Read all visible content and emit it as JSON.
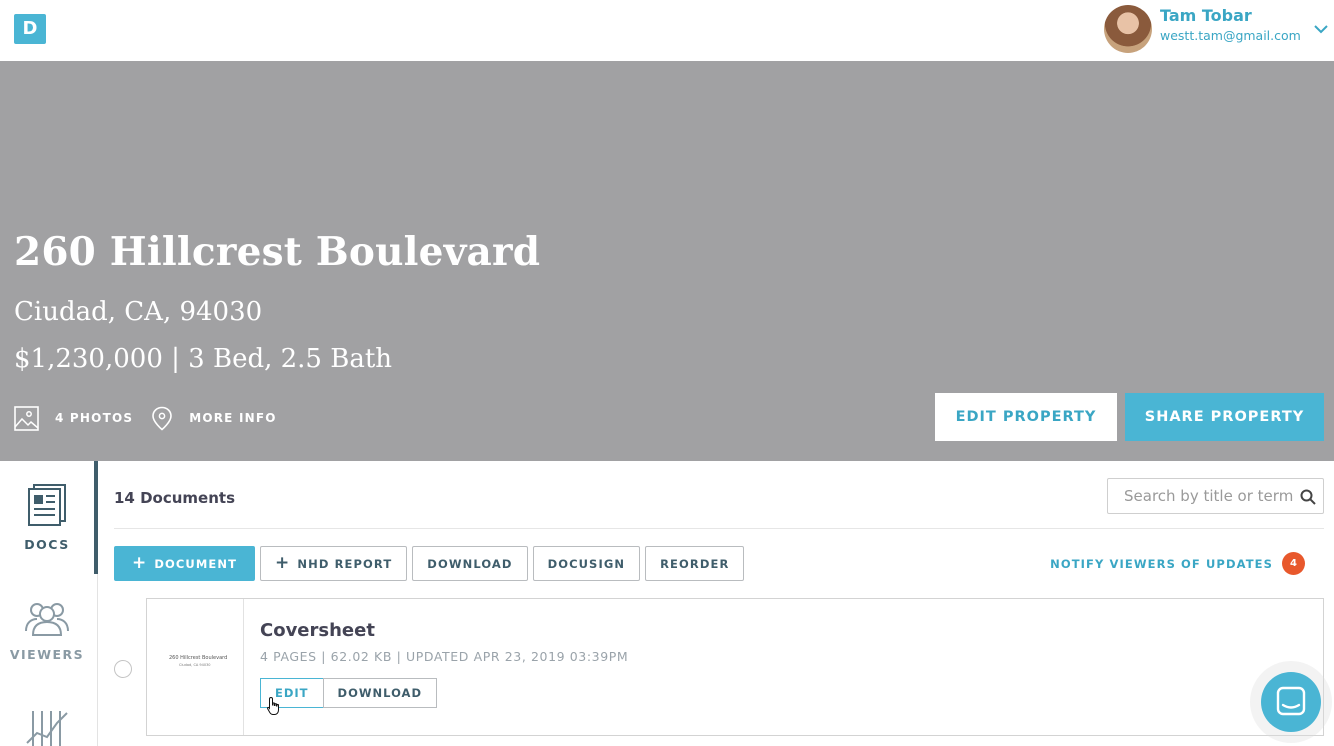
{
  "header": {
    "logo_letter": "D",
    "user_name": "Tam Tobar",
    "user_email": "westt.tam@gmail.com"
  },
  "property": {
    "address": "260 Hillcrest Boulevard",
    "city_line": "Ciudad, CA, 94030",
    "details_line": "$1,230,000 | 3 Bed, 2.5 Bath",
    "photos_label": "4 PHOTOS",
    "more_info_label": "MORE INFO",
    "edit_label": "EDIT PROPERTY",
    "share_label": "SHARE PROPERTY"
  },
  "sidebar": {
    "items": [
      {
        "label": "DOCS",
        "icon": "docs-icon",
        "active": true
      },
      {
        "label": "VIEWERS",
        "icon": "viewers-icon",
        "active": false
      },
      {
        "label": "",
        "icon": "analytics-icon",
        "active": false
      }
    ]
  },
  "documents": {
    "count_label": "14 Documents",
    "search_placeholder": "Search by title or term",
    "toolbar": {
      "add_document": "DOCUMENT",
      "nhd_report": "NHD REPORT",
      "download": "DOWNLOAD",
      "docusign": "DOCUSIGN",
      "reorder": "REORDER"
    },
    "notify_label": "NOTIFY VIEWERS OF UPDATES",
    "notify_count": "4",
    "items": [
      {
        "title": "Coversheet",
        "meta": "4 PAGES | 62.02 KB | UPDATED APR 23, 2019 03:39PM",
        "thumb_line1": "260 Hillcrest Boulevard",
        "thumb_line2": "Ciudad, CA 94030",
        "edit_label": "EDIT",
        "download_label": "DOWNLOAD"
      }
    ]
  },
  "colors": {
    "accent": "#4ab5d4",
    "hero_bg": "#a1a1a3",
    "badge": "#e8582c",
    "sidebar_active": "#3f5d6b"
  }
}
